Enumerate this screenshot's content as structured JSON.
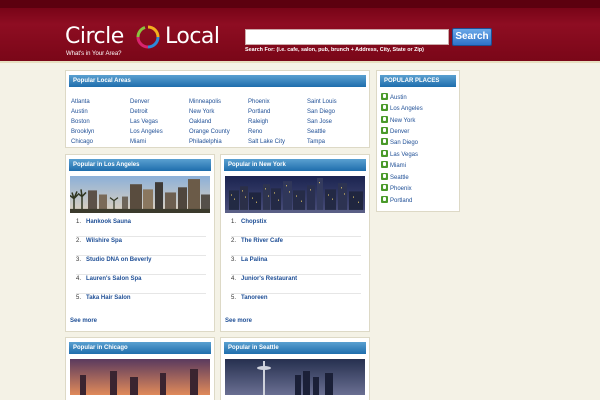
{
  "header": {
    "logo_left": "Circle",
    "logo_right": "Local",
    "tagline": "What's in Your Area?",
    "search_value": "",
    "search_button": "Search",
    "search_hint": "Search For: (i.e. cafe, salon, pub, brunch + Address, City, State or Zip)"
  },
  "areas": {
    "title": "Popular Local Areas",
    "columns": [
      [
        "Atlanta",
        "Austin",
        "Boston",
        "Brooklyn",
        "Chicago"
      ],
      [
        "Denver",
        "Detroit",
        "Las Vegas",
        "Los Angeles",
        "Miami"
      ],
      [
        "Minneapolis",
        "New York",
        "Oakland",
        "Orange County",
        "Philadelphia"
      ],
      [
        "Phoenix",
        "Portland",
        "Raleigh",
        "Reno",
        "Salt Lake City"
      ],
      [
        "Saint Louis",
        "San Diego",
        "San Jose",
        "Seattle",
        "Tampa"
      ]
    ]
  },
  "popular_places": {
    "title": "POPULAR PLACES",
    "items": [
      "Austin",
      "Los Angeles",
      "New York",
      "Denver",
      "San Diego",
      "Las Vegas",
      "Miami",
      "Seattle",
      "Phoenix",
      "Portland"
    ]
  },
  "la": {
    "title": "Popular in Los Angeles",
    "items": [
      "Hankook Sauna",
      "Wilshire Spa",
      "Studio DNA on Beverly",
      "Lauren's Salon Spa",
      "Taka Hair Salon"
    ],
    "see_more": "See more"
  },
  "ny": {
    "title": "Popular in New York",
    "items": [
      "Chopstix",
      "The River Cafe",
      "La Palina",
      "Junior's Restaurant",
      "Tanoreen"
    ],
    "see_more": "See more"
  },
  "chicago": {
    "title": "Popular in Chicago"
  },
  "seattle": {
    "title": "Popular in Seattle"
  },
  "colors": {
    "header": "#8e0d22",
    "panel_title": "#1f6eac",
    "link": "#1f4f96",
    "thumb": "#4a9a2a"
  }
}
